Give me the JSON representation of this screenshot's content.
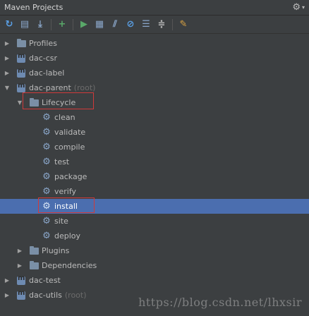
{
  "window": {
    "title": "Maven Projects"
  },
  "toolbar": {
    "icons": [
      "refresh-icon",
      "reimport-icon",
      "download-icon",
      "add-icon",
      "run-icon",
      "execute-goal-icon",
      "toggle-offline-icon",
      "skip-tests-icon",
      "show-dependencies-icon",
      "collapse-all-icon",
      "settings-icon"
    ]
  },
  "tree": {
    "profiles": "Profiles",
    "dac_csr": "dac-csr",
    "dac_label": "dac-label",
    "dac_parent": "dac-parent",
    "dac_parent_root": "(root)",
    "lifecycle": "Lifecycle",
    "goals": [
      "clean",
      "validate",
      "compile",
      "test",
      "package",
      "verify",
      "install",
      "site",
      "deploy"
    ],
    "plugins": "Plugins",
    "dependencies": "Dependencies",
    "dac_test": "dac-test",
    "dac_utils": "dac-utils",
    "dac_utils_root": "(root)"
  },
  "watermark": "https://blog.csdn.net/lhxsir",
  "colors": {
    "selection": "#4b6eaf",
    "highlight_box": "#d03a3a",
    "background": "#3c3f41"
  }
}
